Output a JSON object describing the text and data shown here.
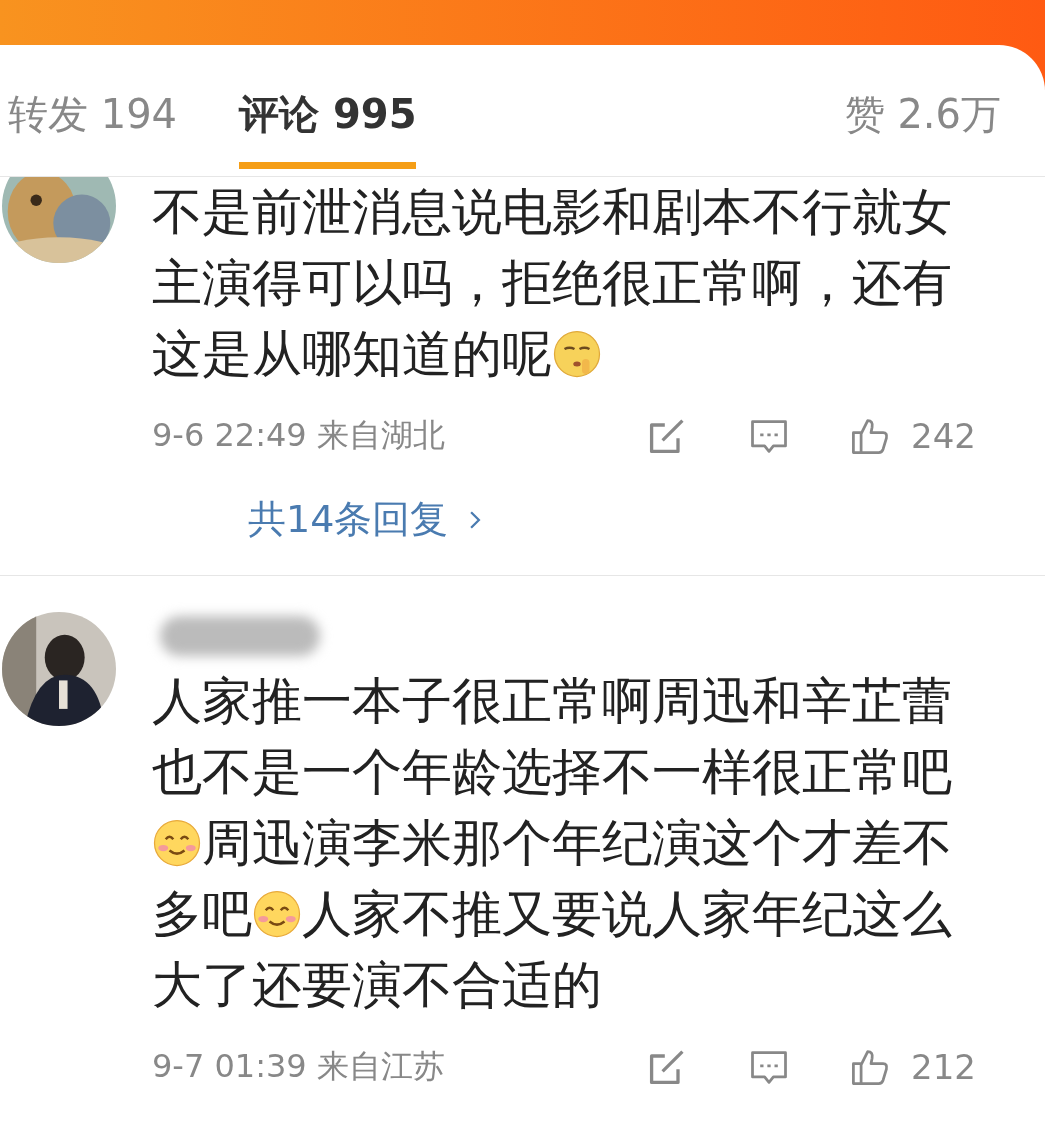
{
  "tabs": [
    {
      "label": "转发 194",
      "selected": false
    },
    {
      "label": "评论 995",
      "selected": true
    },
    {
      "label": "赞 2.6万",
      "selected": false
    }
  ],
  "comments": [
    {
      "avatar": {
        "kind": "picture"
      },
      "name_redacted": false,
      "segments": [
        {
          "kind": "text",
          "text": "不是前泄消息说电影和剧本不行就女主演得可以吗，拒绝很正常啊，还有这是从哪知道的呢"
        },
        {
          "kind": "hush"
        }
      ],
      "time": "9-6 22:49",
      "location": "来自湖北",
      "likes": "242",
      "replies": "共14条回复"
    },
    {
      "avatar": {
        "kind": "picture"
      },
      "name_redacted": true,
      "segments": [
        {
          "kind": "text",
          "text": "人家推一本子很正常啊周迅和辛芷蕾也不是一个年龄选择不一样很正常吧"
        },
        {
          "kind": "smile"
        },
        {
          "kind": "text",
          "text": "周迅演李米那个年纪演这个才差不多吧"
        },
        {
          "kind": "smile"
        },
        {
          "kind": "text",
          "text": "人家不推又要说人家年纪这么大了还要演不合适的"
        }
      ],
      "time": "9-7 01:39",
      "location": "来自江苏",
      "likes": "212"
    }
  ]
}
